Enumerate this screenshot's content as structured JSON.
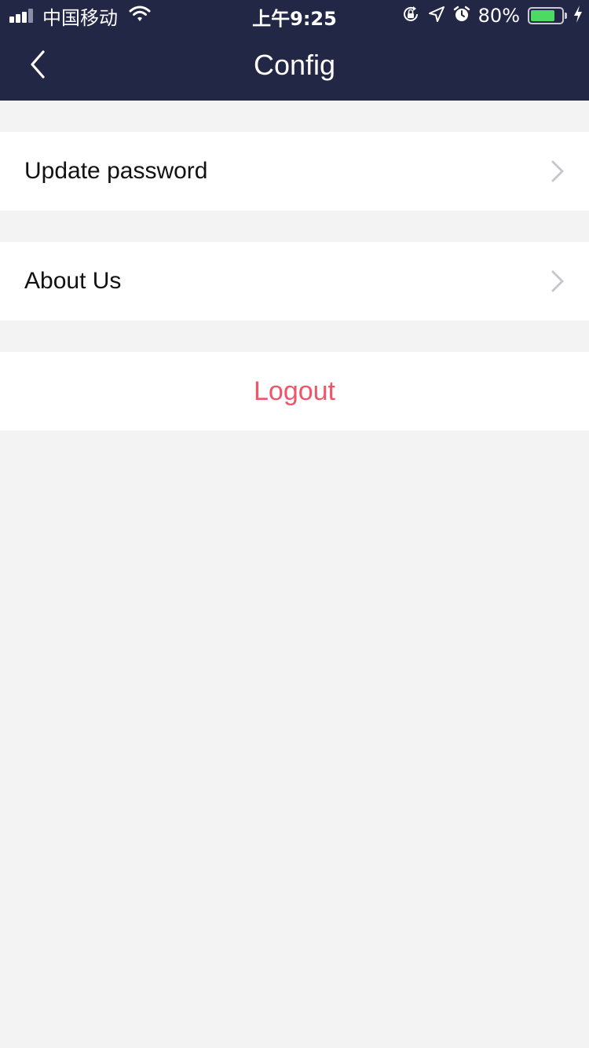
{
  "status_bar": {
    "carrier": "中国移动",
    "time": "上午9:25",
    "battery_percent": "80%",
    "battery_level": 0.8,
    "icons": [
      "signal-icon",
      "wifi-icon",
      "orientation-lock-icon",
      "location-icon",
      "alarm-icon",
      "battery-icon",
      "charging-bolt-icon"
    ]
  },
  "nav": {
    "title": "Config",
    "back_icon": "chevron-left-icon"
  },
  "menu": {
    "items": [
      {
        "label": "Update password",
        "icon": "chevron-right-icon"
      },
      {
        "label": "About Us",
        "icon": "chevron-right-icon"
      }
    ],
    "logout_label": "Logout"
  },
  "colors": {
    "header_bg": "#232746",
    "page_bg": "#f3f3f3",
    "logout_text": "#f0566a",
    "chevron": "#c7c7cc",
    "battery_fill": "#4cd964"
  }
}
